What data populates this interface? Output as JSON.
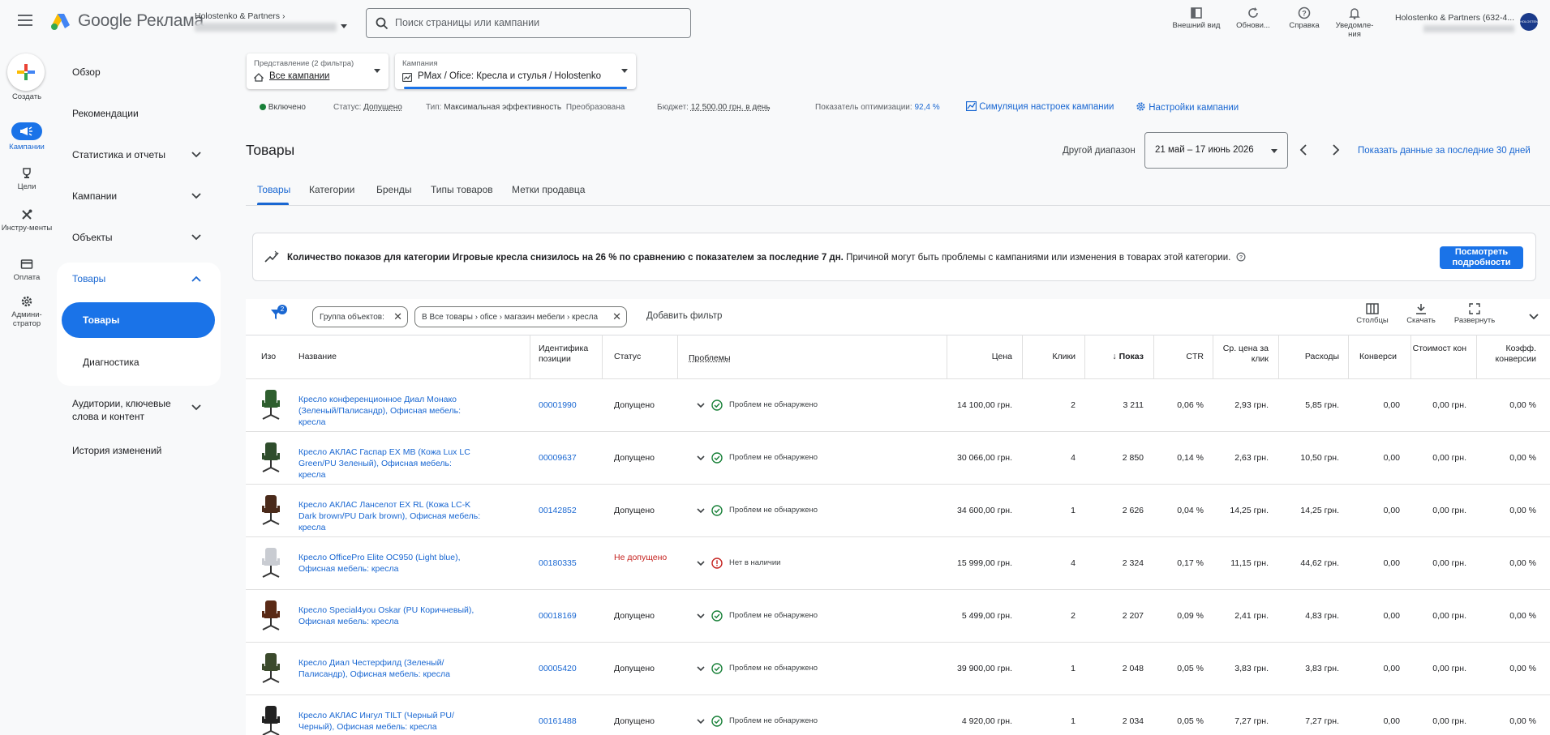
{
  "app": {
    "logo_text": "Google Реклама",
    "account_name": "Holostenko & Partners",
    "search_placeholder": "Поиск страницы или кампании",
    "toolbar": [
      {
        "label": "Внешний вид",
        "icon": "appearance-icon"
      },
      {
        "label": "Обнови...",
        "icon": "refresh-icon"
      },
      {
        "label": "Справка",
        "icon": "help-icon"
      },
      {
        "label": "Уведомле-ния",
        "icon": "bell-icon"
      }
    ],
    "user_account": "Holostenko & Partners (632-4...",
    "avatar_text": "HOLOSTENKO"
  },
  "rail": {
    "create": "Создать",
    "campaigns": "Кампании",
    "goals": "Цели",
    "tools": "Инстру-менты",
    "billing": "Оплата",
    "admin": "Админи-стратор"
  },
  "nav": {
    "overview": "Обзор",
    "recommendations": "Рекомендации",
    "stats": "Статистика и отчеты",
    "campaigns": "Кампании",
    "assets": "Объекты",
    "products": "Товары",
    "products_sub": "Товары",
    "diagnostics": "Диагностика",
    "audiences": "Аудитории, ключевые слова и контент",
    "history": "История изменений"
  },
  "filters": {
    "view_label": "Представление (2 фильтра)",
    "view_value": "Все кампании",
    "campaign_label": "Кампания",
    "campaign_value": "PMax / Ofice: Кресла и стулья / Holostenko"
  },
  "status_bar": {
    "enabled": "Включено",
    "status_label": "Статус:",
    "status_value": "Допущено",
    "type_label": "Тип:",
    "type_value": "Максимальная эффективность",
    "converted": "Преобразована",
    "budget_label": "Бюджет:",
    "budget_value": "12 500,00 грн. в день",
    "opt_label": "Показатель оптимизации:",
    "opt_value": "92,4 %",
    "simulation": "Симуляция настроек кампании",
    "settings": "Настройки кампании"
  },
  "page": {
    "title": "Товары",
    "date_other": "Другой диапазон",
    "date_range": "21 май – 17 июнь 2026",
    "show_last_30": "Показать данные за последние 30 дней",
    "tabs": [
      "Товары",
      "Категории",
      "Бренды",
      "Типы товаров",
      "Метки продавца"
    ]
  },
  "alert": {
    "text_bold": "Количество показов для категории Игровые кресла снизилось на 26 % по сравнению с показателем за последние 7 дн.",
    "text_rest": " Причиной могут быть проблемы с кампаниями или изменения в товарах этой категории.",
    "button": "Посмотреть подробности"
  },
  "table_toolbar": {
    "filter_count": "2",
    "chip1": "Группа объектов:",
    "chip2": "В Все товары › ofice › магазин мебели › кресла",
    "add_filter": "Добавить фильтр",
    "columns": "Столбцы",
    "download": "Скачать",
    "expand": "Развернуть"
  },
  "columns": {
    "image": "Изо",
    "name": "Название",
    "id": "Идентифика позиции",
    "status": "Статус",
    "issues": "Проблемы",
    "price": "Цена",
    "clicks": "Клики",
    "impr": "Показ",
    "ctr": "CTR",
    "cpc": "Ср. цена за клик",
    "cost": "Расходы",
    "conv": "Конверси",
    "cost_conv": "Стоимост кон",
    "conv_rate": "Коэфф. конверсии"
  },
  "rows": [
    {
      "name": "Кресло конференционное Диал Монако (Зеленый/Палисандр), Офисная мебель: кресла",
      "id": "00001990",
      "status": "Допущено",
      "issue": "Проблем не обнаружено",
      "price": "14 100,00 грн.",
      "clicks": "2",
      "impr": "3 211",
      "ctr": "0,06 %",
      "cpc": "2,93 грн.",
      "cost": "5,85 грн.",
      "conv": "0,00",
      "cost_conv": "0,00 грн.",
      "conv_rate": "0,00 %"
    },
    {
      "name": "Кресло АКЛАС Гаспар EX MB (Кожа Lux LC Green/PU Зеленый), Офисная мебель: кресла",
      "id": "00009637",
      "status": "Допущено",
      "issue": "Проблем не обнаружено",
      "price": "30 066,00 грн.",
      "clicks": "4",
      "impr": "2 850",
      "ctr": "0,14 %",
      "cpc": "2,63 грн.",
      "cost": "10,50 грн.",
      "conv": "0,00",
      "cost_conv": "0,00 грн.",
      "conv_rate": "0,00 %"
    },
    {
      "name": "Кресло АКЛАС Ланселот EX RL (Кожа LC-K Dark brown/PU Dark brown), Офисная мебель: кресла",
      "id": "00142852",
      "status": "Допущено",
      "issue": "Проблем не обнаружено",
      "price": "34 600,00 грн.",
      "clicks": "1",
      "impr": "2 626",
      "ctr": "0,04 %",
      "cpc": "14,25 грн.",
      "cost": "14,25 грн.",
      "conv": "0,00",
      "cost_conv": "0,00 грн.",
      "conv_rate": "0,00 %"
    },
    {
      "name": "Кресло OfficePro Elite OC950 (Light blue), Офисная мебель: кресла",
      "id": "00180335",
      "status": "Не допущено",
      "issue": "Нет в наличии",
      "price": "15 999,00 грн.",
      "clicks": "4",
      "impr": "2 324",
      "ctr": "0,17 %",
      "cpc": "11,15 грн.",
      "cost": "44,62 грн.",
      "conv": "0,00",
      "cost_conv": "0,00 грн.",
      "conv_rate": "0,00 %"
    },
    {
      "name": "Кресло Special4you Oskar (PU Коричневый), Офисная мебель: кресла",
      "id": "00018169",
      "status": "Допущено",
      "issue": "Проблем не обнаружено",
      "price": "5 499,00 грн.",
      "clicks": "2",
      "impr": "2 207",
      "ctr": "0,09 %",
      "cpc": "2,41 грн.",
      "cost": "4,83 грн.",
      "conv": "0,00",
      "cost_conv": "0,00 грн.",
      "conv_rate": "0,00 %"
    },
    {
      "name": "Кресло Диал Честерфилд (Зеленый/Палисандр), Офисная мебель: кресла",
      "id": "00005420",
      "status": "Допущено",
      "issue": "Проблем не обнаружено",
      "price": "39 900,00 грн.",
      "clicks": "1",
      "impr": "2 048",
      "ctr": "0,05 %",
      "cpc": "3,83 грн.",
      "cost": "3,83 грн.",
      "conv": "0,00",
      "cost_conv": "0,00 грн.",
      "conv_rate": "0,00 %"
    },
    {
      "name": "Кресло АКЛАС Ингул TILT (Черный PU/Черный), Офисная мебель: кресла",
      "id": "00161488",
      "status": "Допущено",
      "issue": "Проблем не обнаружено",
      "price": "4 920,00 грн.",
      "clicks": "1",
      "impr": "2 034",
      "ctr": "0,05 %",
      "cpc": "7,27 грн.",
      "cost": "7,27 грн.",
      "conv": "0,00",
      "cost_conv": "0,00 грн.",
      "conv_rate": "0,00 %"
    }
  ],
  "colors": {
    "accent": "#1a73e8",
    "link": "#1967d2",
    "ok": "#188038",
    "error": "#c5221f"
  }
}
